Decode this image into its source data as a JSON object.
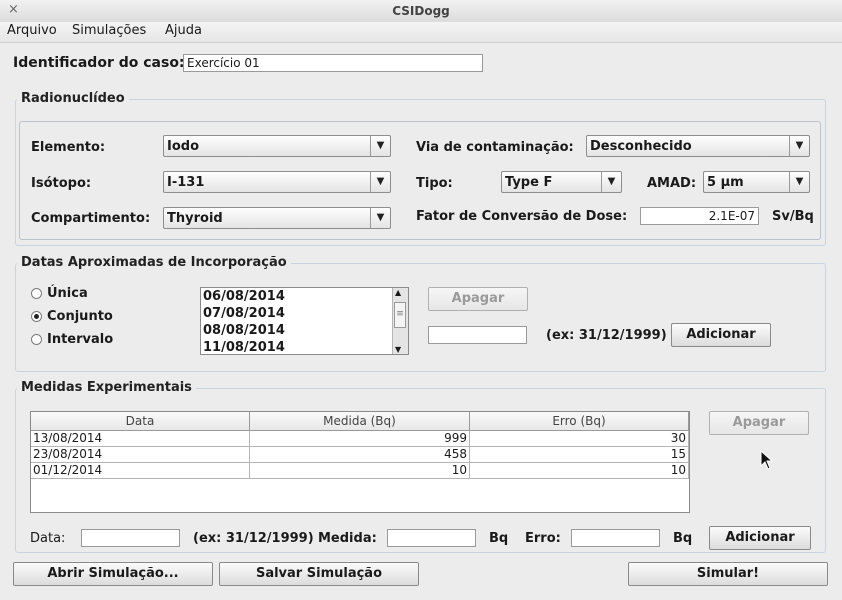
{
  "window": {
    "title": "CSIDogg",
    "close_glyph": "×"
  },
  "menu": [
    "Arquivo",
    "Simulações",
    "Ajuda"
  ],
  "case": {
    "label": "Identificador do caso:",
    "value": "Exercício 01"
  },
  "radionuclide": {
    "title": "Radionuclídeo",
    "element_label": "Elemento:",
    "element_value": "Iodo",
    "isotope_label": "Isótopo:",
    "isotope_value": "I-131",
    "compartment_label": "Compartimento:",
    "compartment_value": "Thyroid",
    "route_label": "Via de contaminação:",
    "route_value": "Desconhecido",
    "type_label": "Tipo:",
    "type_value": "Type F",
    "amad_label": "AMAD:",
    "amad_value": "5 µm",
    "dcf_label": "Fator de Conversão de Dose:",
    "dcf_value": "2.1E-07",
    "dcf_unit": "Sv/Bq"
  },
  "dates": {
    "title": "Datas Aproximadas de Incorporação",
    "radio_single": "Única",
    "radio_set": "Conjunto",
    "radio_interval": "Intervalo",
    "selected": "Conjunto",
    "list": [
      "06/08/2014",
      "07/08/2014",
      "08/08/2014",
      "11/08/2014"
    ],
    "delete_button": "Apagar",
    "input_value": "",
    "hint": "(ex: 31/12/1999)",
    "add_button": "Adicionar"
  },
  "measurements": {
    "title": "Medidas Experimentais",
    "columns": [
      "Data",
      "Medida (Bq)",
      "Erro (Bq)"
    ],
    "rows": [
      [
        "13/08/2014",
        "999",
        "30"
      ],
      [
        "23/08/2014",
        "458",
        "15"
      ],
      [
        "01/12/2014",
        "10",
        "10"
      ]
    ],
    "delete_button": "Apagar",
    "date_label": "Data:",
    "date_hint": "(ex: 31/12/1999)",
    "measure_label": "Medida:",
    "measure_unit": "Bq",
    "error_label": "Erro:",
    "error_unit": "Bq",
    "add_button": "Adicionar"
  },
  "footer": {
    "open_button": "Abrir Simulação...",
    "save_button": "Salvar Simulação",
    "simulate_button": "Simular!"
  }
}
